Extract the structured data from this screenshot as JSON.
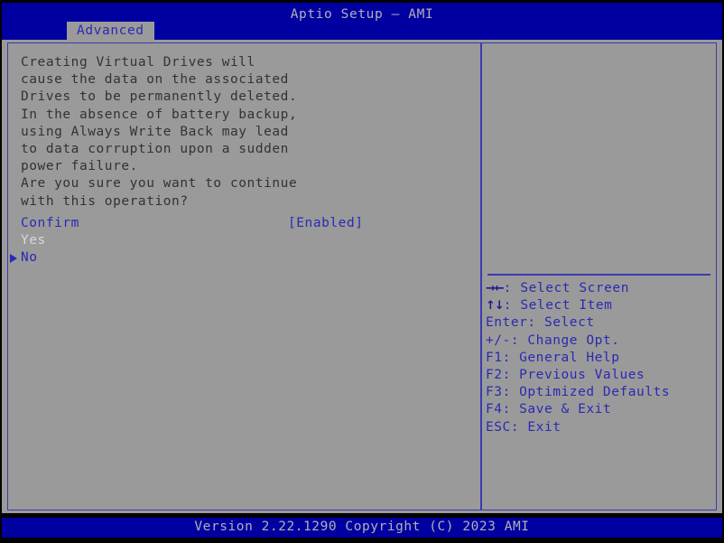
{
  "titlebar": {
    "title": "Aptio Setup – AMI"
  },
  "tabs": [
    {
      "label": "Advanced",
      "active": true
    }
  ],
  "main": {
    "warning_lines": [
      "Creating Virtual Drives will",
      "cause the data on the associated",
      "Drives to be permanently deleted.",
      "In the absence of battery backup,",
      "using Always Write Back may lead",
      "to data corruption upon a sudden",
      "power failure.",
      "Are you sure you want to continue",
      "with this operation?"
    ],
    "options": [
      {
        "label": "Confirm",
        "value": "[Enabled]",
        "style": "blue",
        "marker": false
      },
      {
        "label": "Yes",
        "value": "",
        "style": "white",
        "marker": false
      },
      {
        "label": "No",
        "value": "",
        "style": "blue",
        "marker": true
      }
    ]
  },
  "help": {
    "keys": [
      {
        "key": "→←",
        "text": ": Select Screen",
        "arrow": true
      },
      {
        "key": "↑↓",
        "text": ": Select Item",
        "arrow": true
      },
      {
        "key": "Enter",
        "text": ": Select",
        "arrow": false
      },
      {
        "key": "+/-",
        "text": ": Change Opt.",
        "arrow": false
      },
      {
        "key": "F1",
        "text": ": General Help",
        "arrow": false
      },
      {
        "key": "F2",
        "text": ": Previous Values",
        "arrow": false
      },
      {
        "key": "F3",
        "text": ": Optimized Defaults",
        "arrow": false
      },
      {
        "key": "F4",
        "text": ": Save & Exit",
        "arrow": false
      },
      {
        "key": "ESC",
        "text": ": Exit",
        "arrow": false
      }
    ]
  },
  "footer": {
    "version_text": "Version 2.22.1290 Copyright (C) 2023 AMI"
  },
  "colors": {
    "header_blue": "#0000a0",
    "panel_gray": "#9a9a9a",
    "accent_blue": "#2a2ab4",
    "border_blue": "#3b3bb0",
    "text_dark": "#333333",
    "text_light": "#d8d8d8"
  }
}
